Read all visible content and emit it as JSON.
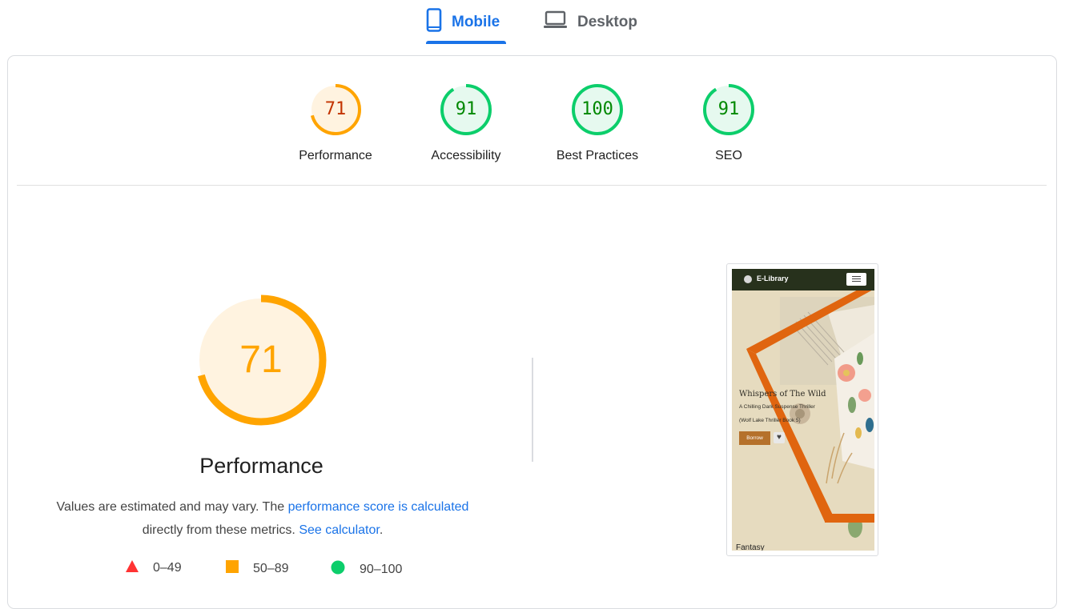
{
  "tabs": [
    {
      "label": "Mobile",
      "active": true,
      "icon": "smartphone-icon"
    },
    {
      "label": "Desktop",
      "active": false,
      "icon": "laptop-icon"
    }
  ],
  "scores": [
    {
      "label": "Performance",
      "value": "71",
      "score": 71,
      "rating": "average"
    },
    {
      "label": "Accessibility",
      "value": "91",
      "score": 91,
      "rating": "pass"
    },
    {
      "label": "Best Practices",
      "value": "100",
      "score": 100,
      "rating": "pass"
    },
    {
      "label": "SEO",
      "value": "91",
      "score": 91,
      "rating": "pass"
    }
  ],
  "colors": {
    "accent": "#1a73e8",
    "average_stroke": "#ffa400",
    "average_fill": "#fff3e0",
    "average_text": "#c33300",
    "pass_stroke": "#0cce6b",
    "pass_fill": "#e6f9ef",
    "pass_text": "#008800",
    "fail": "#ff3333"
  },
  "detail": {
    "score": "71",
    "score_value": 71,
    "title": "Performance",
    "desc_prefix": "Values are estimated and may vary. The ",
    "desc_link1": "performance score is calculated",
    "desc_middle": " directly from these metrics. ",
    "desc_link2": "See calculator",
    "desc_suffix": "."
  },
  "legend": [
    {
      "range": "0–49",
      "shape": "triangle-icon"
    },
    {
      "range": "50–89",
      "shape": "square-icon"
    },
    {
      "range": "90–100",
      "shape": "circle-icon"
    }
  ],
  "screenshot": {
    "site_name": "E-Library",
    "hero_title": "Whispers of The Wild",
    "hero_subtitle1": "A Chilling Dark Suspense Thriller",
    "hero_subtitle2": "(Wolf Lake Thriller Book 5)",
    "borrow_label": "Borrow",
    "heart_icon": "♥",
    "section_label": "Fantasy"
  }
}
